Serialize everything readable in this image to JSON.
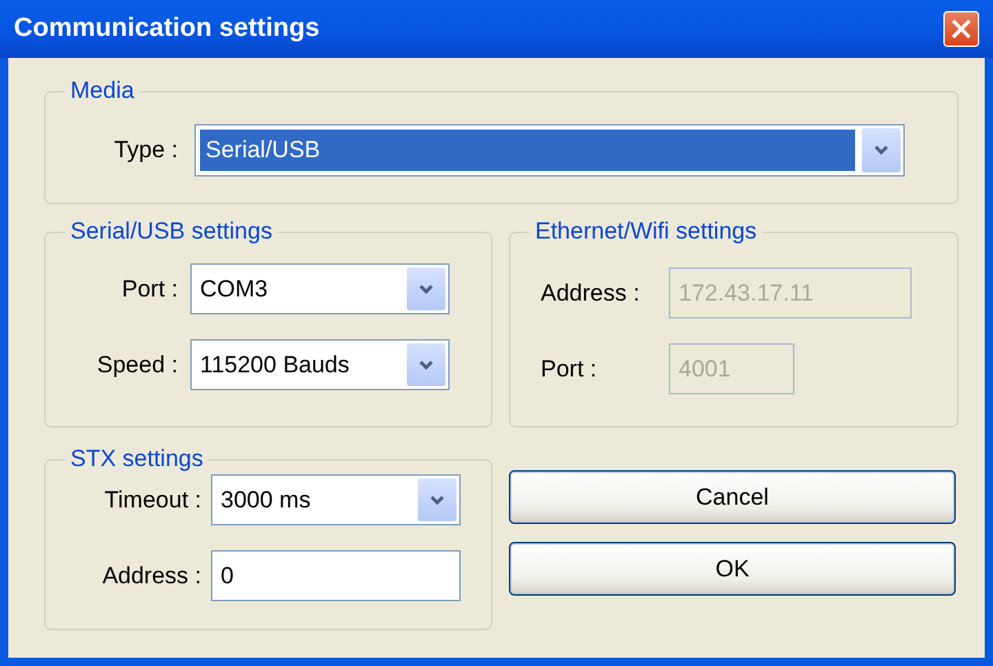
{
  "window": {
    "title": "Communication settings"
  },
  "groups": [
    {
      "title": "Media",
      "fields": [
        {
          "kind": "combo",
          "label": "Type :",
          "value": "Serial/USB",
          "focused": true,
          "disabled": false
        }
      ]
    },
    {
      "title": "Serial/USB settings",
      "fields": [
        {
          "kind": "combo",
          "label": "Port :",
          "value": "COM3",
          "focused": false,
          "disabled": false
        },
        {
          "kind": "combo",
          "label": "Speed :",
          "value": "115200 Bauds",
          "focused": false,
          "disabled": false
        }
      ]
    },
    {
      "title": "Ethernet/Wifi settings",
      "fields": [
        {
          "kind": "text",
          "label": "Address :",
          "value": "172.43.17.11",
          "focused": false,
          "disabled": true
        },
        {
          "kind": "text",
          "label": "Port :",
          "value": "4001",
          "focused": false,
          "disabled": true
        }
      ]
    },
    {
      "title": "STX settings",
      "fields": [
        {
          "kind": "combo",
          "label": "Timeout :",
          "value": "3000 ms",
          "focused": false,
          "disabled": false
        },
        {
          "kind": "text",
          "label": "Address :",
          "value": "0",
          "focused": false,
          "disabled": false
        }
      ]
    }
  ],
  "buttons": [
    {
      "label": "Cancel"
    },
    {
      "label": "OK"
    }
  ]
}
